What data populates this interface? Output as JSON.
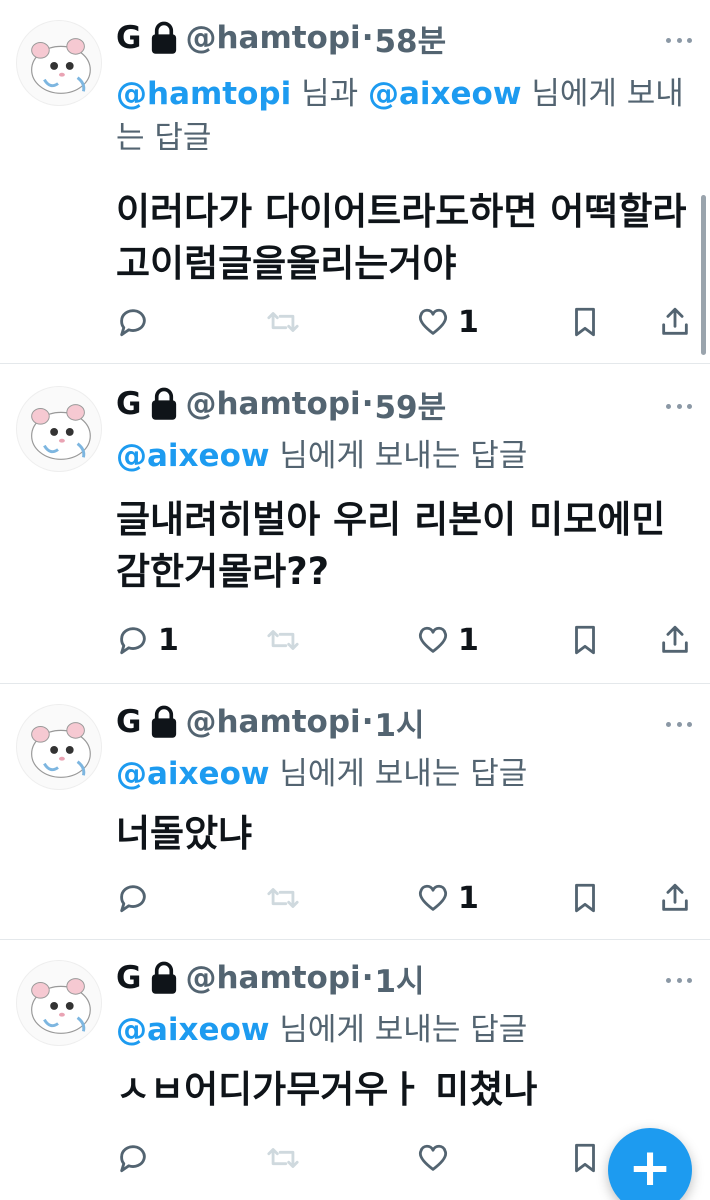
{
  "tweets": [
    {
      "display_name": "G",
      "handle": "@hamtopi",
      "separator": "·",
      "time": "58분",
      "replying_mention_1": "@hamtopi",
      "replying_mid": " 님과 ",
      "replying_mention_2": "@aixeow",
      "replying_suffix": " 님에게 보내는 답글",
      "text": "이러다가 다이어트라도하면 어떡할라고이럼글을올리는거야",
      "reply_count": "",
      "like_count": "1"
    },
    {
      "display_name": "G",
      "handle": "@hamtopi",
      "separator": "·",
      "time": "59분",
      "replying_mention": "@aixeow",
      "replying_suffix": " 님에게 보내는 답글",
      "text": "글내려히벌아 우리 리본이 미모에민감한거몰라??",
      "reply_count": "1",
      "like_count": "1"
    },
    {
      "display_name": "G",
      "handle": "@hamtopi",
      "separator": "·",
      "time": "1시",
      "replying_mention": "@aixeow",
      "replying_suffix": " 님에게 보내는 답글",
      "text": "너돌았냐",
      "reply_count": "",
      "like_count": "1"
    },
    {
      "display_name": "G",
      "handle": "@hamtopi",
      "separator": "·",
      "time": "1시",
      "replying_mention": "@aixeow",
      "replying_suffix": " 님에게 보내는 답글",
      "text": "ㅅㅂ어디가무거우ㅏ 미쳤나",
      "reply_count": "",
      "like_count": ""
    }
  ],
  "icons": {
    "lock": "lock-icon",
    "more": "more-icon",
    "reply": "reply-icon",
    "retweet": "retweet-icon",
    "like": "heart-icon",
    "bookmark": "bookmark-icon",
    "share": "share-icon",
    "compose": "plus-icon"
  },
  "fab": {
    "symbol": "+"
  },
  "colors": {
    "accent": "#1d9bf0",
    "text": "#0f1419",
    "secondary": "#536471",
    "retweet_disabled": "#cfd9de"
  }
}
